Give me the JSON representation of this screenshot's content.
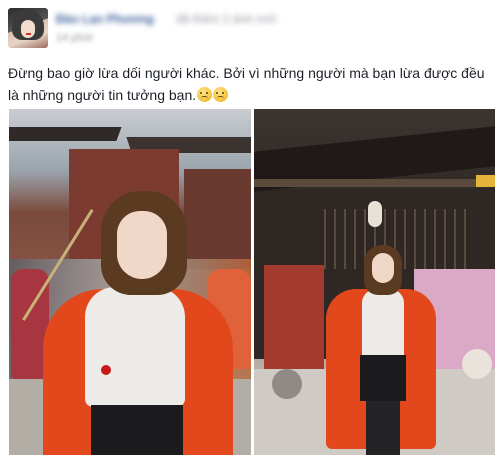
{
  "post": {
    "author": {
      "name": "Đào Lan Phương",
      "extra": "đã thêm 2 ảnh mới",
      "timestamp": "14 phút"
    },
    "status_text": "Đừng bao giờ lừa dối người khác. Bởi vì những người mà bạn lừa được đều là những người tin tưởng bạn.",
    "emojis": [
      "crying-face-emoji",
      "crying-face-emoji"
    ],
    "photos": [
      {
        "name": "woman-with-candied-fruit-photo"
      },
      {
        "name": "woman-in-front-of-pagoda-photo"
      }
    ]
  }
}
